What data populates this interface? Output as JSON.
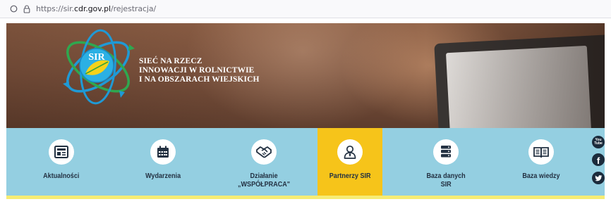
{
  "browser": {
    "url_prefix": "https://sir.",
    "url_domain": "cdr.gov.pl",
    "url_path": "/rejestracja/"
  },
  "header": {
    "logo_text": "SIR",
    "title_lines": [
      "SIEĆ NA RZECZ",
      "INNOWACJI W ROLNICTWIE",
      "I NA OBSZARACH WIEJSKICH"
    ]
  },
  "nav": {
    "items": [
      {
        "label": "Aktualności",
        "icon": "newspaper-icon"
      },
      {
        "label": "Wydarzenia",
        "icon": "calendar-icon"
      },
      {
        "label_line1": "Działanie",
        "label_line2": "„WSPÓŁPRACA\"",
        "icon": "handshake-icon"
      },
      {
        "label": "Partnerzy SIR",
        "icon": "person-icon",
        "active": true
      },
      {
        "label_line1": "Baza danych",
        "label_line2": "SIR",
        "icon": "database-icon"
      },
      {
        "label": "Baza wiedzy",
        "icon": "book-icon"
      }
    ]
  },
  "social": {
    "youtube_line1": "You",
    "youtube_line2": "Tube",
    "facebook": "f"
  },
  "colors": {
    "nav_bg": "#94cfe1",
    "active_bg": "#f6c41a",
    "stripe": "#f6ec74",
    "label": "#233142"
  }
}
